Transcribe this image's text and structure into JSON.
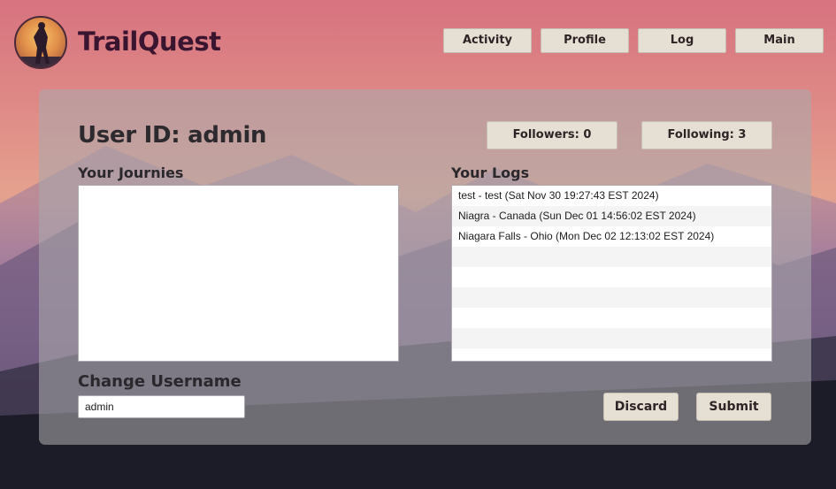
{
  "app": {
    "title": "TrailQuest"
  },
  "nav": {
    "items": [
      {
        "label": "Activity"
      },
      {
        "label": "Profile"
      },
      {
        "label": "Log"
      },
      {
        "label": "Main"
      }
    ]
  },
  "profile": {
    "user_id_text": "User ID: admin",
    "followers_label": "Followers: 0",
    "following_label": "Following: 3"
  },
  "journeys": {
    "heading": "Your Journies",
    "items": []
  },
  "logs": {
    "heading": "Your Logs",
    "items": [
      {
        "text": "test - test (Sat Nov 30 19:27:43 EST 2024)"
      },
      {
        "text": "Niagra - Canada (Sun Dec 01 14:56:02 EST 2024)"
      },
      {
        "text": "Niagara Falls - Ohio (Mon Dec 02 12:13:02 EST 2024)"
      }
    ]
  },
  "change_username": {
    "heading": "Change Username",
    "value": "admin",
    "discard_label": "Discard",
    "submit_label": "Submit"
  },
  "icons": {
    "logo": "hiker-logo-icon"
  },
  "colors": {
    "button_bg": "#e6dfd4",
    "brand_text": "#3a1530",
    "panel_bg": "rgba(170,168,172,0.58)"
  }
}
